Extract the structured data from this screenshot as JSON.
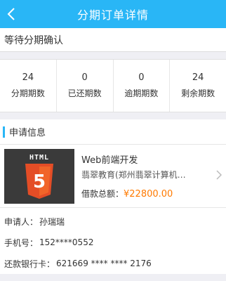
{
  "nav": {
    "title": "分期订单详情",
    "back_icon": "chevron-left-icon"
  },
  "status": {
    "text": "等待分期确认"
  },
  "stats": [
    {
      "value": "24",
      "label": "分期期数"
    },
    {
      "value": "0",
      "label": "已还期数"
    },
    {
      "value": "0",
      "label": "逾期期数"
    },
    {
      "value": "24",
      "label": "剩余期数"
    }
  ],
  "section": {
    "title": "申请信息"
  },
  "product": {
    "image_text": "HTML",
    "image_badge": "5",
    "name": "Web前端开发",
    "org": "翡翠教育(郑州翡翠计算机…",
    "amount_label": "借款总额：",
    "amount_value": "¥22800.00"
  },
  "fields": [
    {
      "label": "申请人：",
      "value": "孙瑞瑞"
    },
    {
      "label": "手机号：",
      "value": "152****0552"
    },
    {
      "label": "还款银行卡：",
      "value": "621669 **** **** 2176"
    }
  ],
  "colors": {
    "primary": "#29b6f6",
    "price": "#ff7a00",
    "html5_orange": "#e44d26"
  }
}
